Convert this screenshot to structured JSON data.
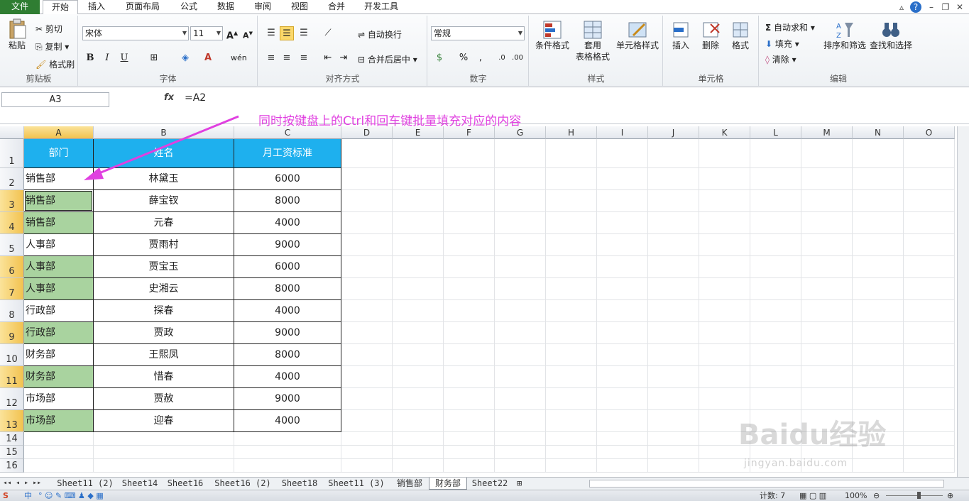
{
  "tabs": {
    "file": "文件",
    "home": "开始",
    "insert": "插入",
    "layout": "页面布局",
    "formula": "公式",
    "data": "数据",
    "review": "审阅",
    "view": "视图",
    "merge": "合并",
    "dev": "开发工具"
  },
  "clipboard": {
    "paste": "粘贴",
    "cut": "剪切",
    "copy": "复制",
    "format_painter": "格式刷",
    "label": "剪贴板"
  },
  "font": {
    "name": "宋体",
    "size": "11",
    "bold": "B",
    "italic": "I",
    "underline": "U",
    "label": "字体"
  },
  "align": {
    "wrap": "自动换行",
    "merge": "合并后居中",
    "label": "对齐方式"
  },
  "number": {
    "format": "常规",
    "label": "数字"
  },
  "styles": {
    "cond": "条件格式",
    "table1": "套用",
    "table2": "表格格式",
    "cell": "单元格样式",
    "label": "样式"
  },
  "cells": {
    "insert": "插入",
    "delete": "删除",
    "format": "格式",
    "label": "单元格"
  },
  "editing": {
    "autosum": "自动求和",
    "fill": "填充",
    "clear": "清除",
    "sort": "排序和筛选",
    "find": "查找和选择",
    "label": "编辑"
  },
  "formula_bar": {
    "name_box": "A3",
    "fx": "fx",
    "value": "=A2"
  },
  "annotation": "同时按键盘上的Ctrl和回车键批量填充对应的内容",
  "columns": [
    "A",
    "B",
    "C",
    "D",
    "E",
    "F",
    "G",
    "H",
    "I",
    "J",
    "K",
    "L",
    "M",
    "N",
    "O"
  ],
  "rows": [
    "1",
    "2",
    "3",
    "4",
    "5",
    "6",
    "7",
    "8",
    "9",
    "10",
    "11",
    "12",
    "13",
    "14",
    "15",
    "16"
  ],
  "headers": [
    "部门",
    "姓名",
    "月工资标准"
  ],
  "table": [
    [
      "销售部",
      "林黛玉",
      "6000"
    ],
    [
      "销售部",
      "薛宝钗",
      "8000"
    ],
    [
      "销售部",
      "元春",
      "4000"
    ],
    [
      "人事部",
      "贾雨村",
      "9000"
    ],
    [
      "人事部",
      "贾宝玉",
      "6000"
    ],
    [
      "人事部",
      "史湘云",
      "8000"
    ],
    [
      "行政部",
      "探春",
      "4000"
    ],
    [
      "行政部",
      "贾政",
      "9000"
    ],
    [
      "财务部",
      "王熙凤",
      "8000"
    ],
    [
      "财务部",
      "惜春",
      "4000"
    ],
    [
      "市场部",
      "贾赦",
      "9000"
    ],
    [
      "市场部",
      "迎春",
      "4000"
    ]
  ],
  "sheet_tabs": [
    "Sheet11 (2)",
    "Sheet14",
    "Sheet16",
    "Sheet16 (2)",
    "Sheet18",
    "Sheet11 (3)",
    "销售部",
    "财务部",
    "Sheet22"
  ],
  "active_sheet": "财务部",
  "status": {
    "count": "计数: 7",
    "zoom": "100%",
    "ime": "中"
  },
  "watermark": {
    "text": "Baidu经验",
    "url": "jingyan.baidu.com"
  },
  "colors": {
    "header_fill": "#1eb0ee",
    "green_fill": "#a9d39f",
    "selected_header": "#f2c24f",
    "annotation": "#e040e0"
  }
}
